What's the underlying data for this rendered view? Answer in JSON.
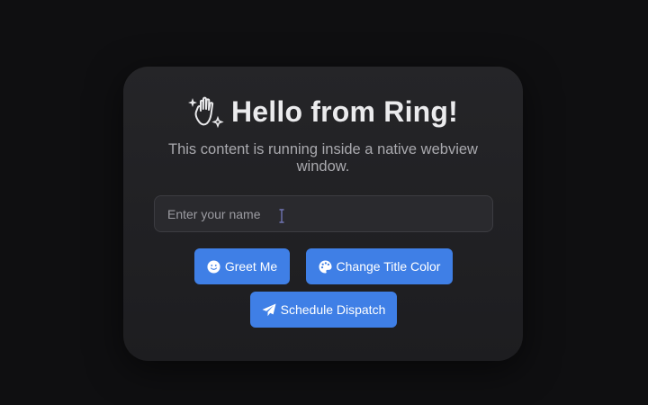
{
  "card": {
    "title": "Hello from Ring!",
    "title_icon": "waving-hand-sparkles-icon",
    "subtitle": "This content is running inside a native webview window."
  },
  "name_input": {
    "value": "",
    "placeholder": "Enter your name"
  },
  "buttons": {
    "greet": {
      "label": "Greet Me",
      "icon": "smiley-face-icon"
    },
    "change_color": {
      "label": "Change Title Color",
      "icon": "palette-icon"
    },
    "dispatch": {
      "label": "Schedule Dispatch",
      "icon": "paper-plane-icon"
    }
  },
  "colors": {
    "background": "#0f0f11",
    "card": "#222225",
    "accent": "#3f7fe6",
    "title": "#ebebed",
    "subtitle": "#a9a9ae"
  }
}
